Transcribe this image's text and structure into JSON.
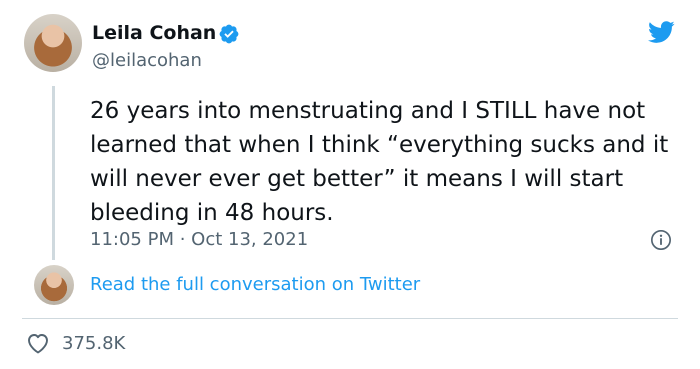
{
  "tweet": {
    "author_name": "Leila Cohan",
    "handle": "@leilacohan",
    "text": "26 years into menstruating and I STILL have not learned that when I think “everything sucks and it will never ever get better” it means I will start bleeding in 48 hours.",
    "timestamp": "11:05 PM · Oct 13, 2021",
    "read_more": "Read the full conversation on Twitter",
    "like_count": "375.8K"
  },
  "icons": {
    "verified": "verified-badge-icon",
    "brand": "twitter-bird-icon",
    "info": "info-icon",
    "like": "heart-icon"
  },
  "colors": {
    "accent": "#1d9bf0",
    "secondary_text": "#536471",
    "divider": "#cfd9de"
  }
}
